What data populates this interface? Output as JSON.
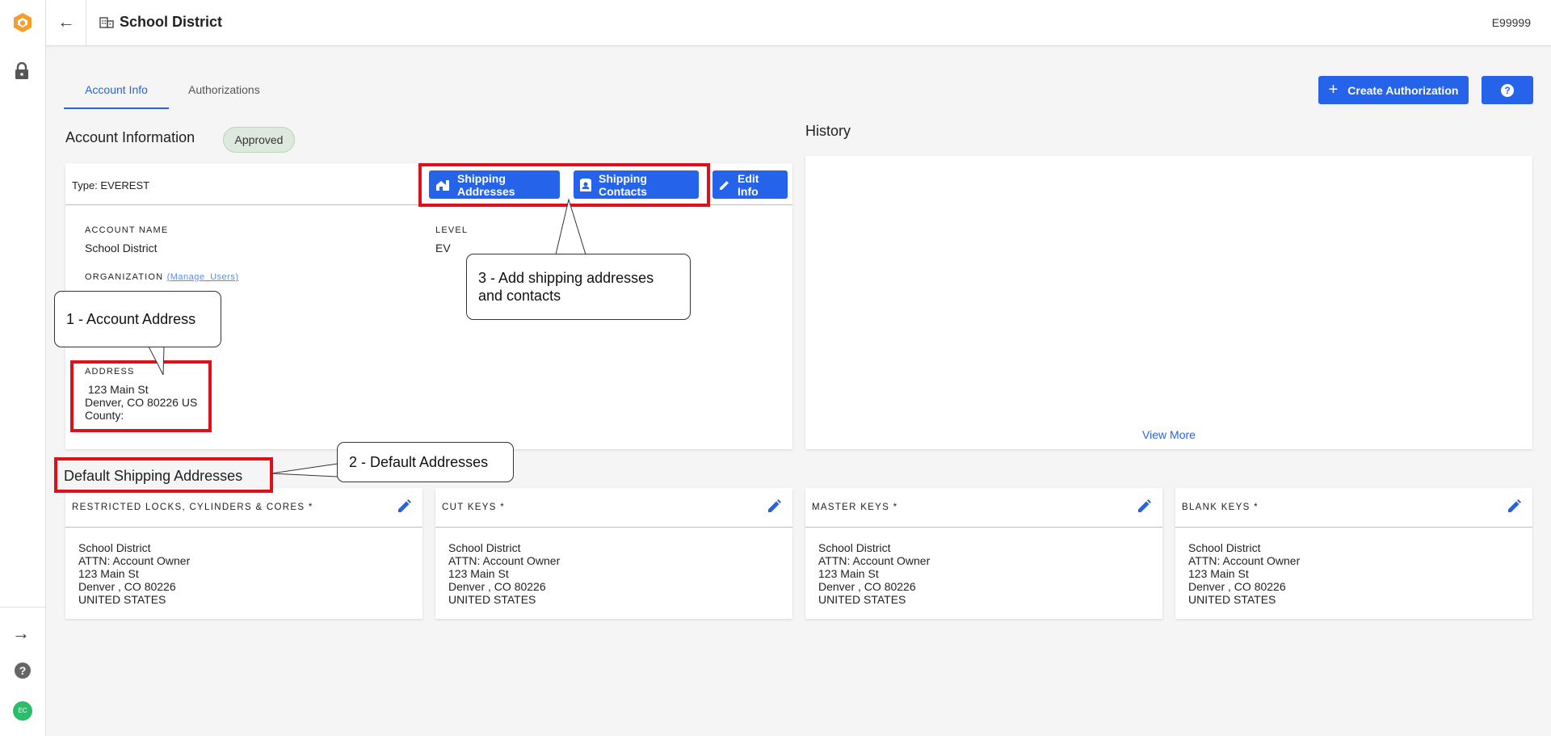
{
  "app": {
    "title": "School District",
    "account_code": "E99999",
    "avatar_initials": "EC"
  },
  "tabs": [
    {
      "label": "Account Info",
      "active": true
    },
    {
      "label": "Authorizations",
      "active": false
    }
  ],
  "actions": {
    "create_authorization": "Create Authorization",
    "help_icon": "?"
  },
  "account": {
    "heading": "Account Information",
    "status": "Approved",
    "type": "Type: EVEREST",
    "buttons": {
      "shipping_addresses": "Shipping Addresses",
      "shipping_contacts": "Shipping Contacts",
      "edit_info": "Edit Info"
    },
    "account_name_label": "ACCOUNT NAME",
    "account_name": "School District",
    "level_label": "LEVEL",
    "level": "EV",
    "organization_label": "ORGANIZATION",
    "manage_users": "(Manage_Users)",
    "address_label": "ADDRESS",
    "address_line1": " 123 Main St",
    "address_line2": "Denver, CO 80226 US",
    "address_line3": "County:"
  },
  "history": {
    "heading": "History",
    "view_more": "View More"
  },
  "default_shipping": {
    "heading": "Default Shipping Addresses",
    "cards": [
      {
        "title": "RESTRICTED LOCKS, CYLINDERS & CORES *",
        "lines": [
          "School District",
          "ATTN: Account Owner",
          "123 Main St",
          "Denver , CO 80226",
          "UNITED STATES"
        ]
      },
      {
        "title": "CUT KEYS *",
        "lines": [
          "School District",
          "ATTN: Account Owner",
          "123 Main St",
          "Denver , CO 80226",
          "UNITED STATES"
        ]
      },
      {
        "title": "MASTER KEYS *",
        "lines": [
          "School District",
          "ATTN: Account Owner",
          "123 Main St",
          "Denver , CO 80226",
          "UNITED STATES"
        ]
      },
      {
        "title": "BLANK KEYS *",
        "lines": [
          "School District",
          "ATTN: Account Owner",
          "123 Main St",
          "Denver , CO 80226",
          "UNITED STATES"
        ]
      }
    ]
  },
  "annotations": {
    "callout1": "1 - Account Address",
    "callout2": "2 - Default Addresses",
    "callout3_line1": "3 - Add shipping addresses",
    "callout3_line2": "and contacts"
  },
  "colors": {
    "primary": "#2563eb",
    "annotation_red": "#e0101a",
    "approved_bg": "#dde9dd",
    "avatar": "#2bbd6a",
    "logo": "#f59e2b"
  }
}
